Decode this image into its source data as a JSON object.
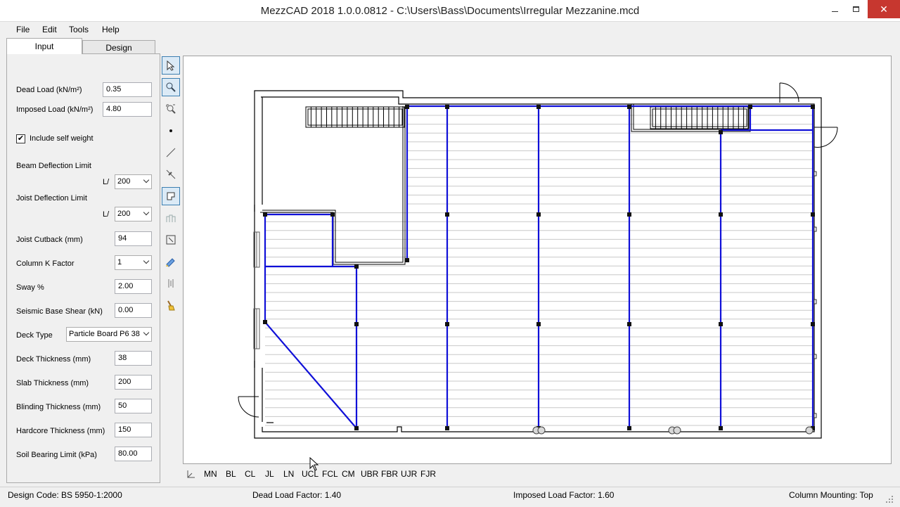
{
  "window": {
    "title": "MezzCAD 2018 1.0.0.0812 - C:\\Users\\Bass\\Documents\\Irregular Mezzanine.mcd",
    "close_glyph": "✕"
  },
  "menu": {
    "file": "File",
    "edit": "Edit",
    "tools": "Tools",
    "help": "Help"
  },
  "tabs": {
    "input": "Input",
    "design": "Design"
  },
  "form": {
    "dead_load_label": "Dead Load (kN/m²)",
    "dead_load_value": "0.35",
    "imposed_load_label": "Imposed Load (kN/m²)",
    "imposed_load_value": "4.80",
    "self_weight_label": "Include self weight",
    "self_weight_checked": "✔",
    "beam_deflection_label": "Beam Deflection Limit",
    "beam_l_prefix": "L/",
    "beam_deflection_value": "200",
    "joist_deflection_label": "Joist Deflection Limit",
    "joist_l_prefix": "L/",
    "joist_deflection_value": "200",
    "joist_cutback_label": "Joist Cutback (mm)",
    "joist_cutback_value": "94",
    "column_k_label": "Column K Factor",
    "column_k_value": "1",
    "sway_label": "Sway %",
    "sway_value": "2.00",
    "seismic_label": "Seismic Base Shear (kN)",
    "seismic_value": "0.00",
    "deck_type_label": "Deck Type",
    "deck_type_value": "Particle Board P6 38",
    "deck_thickness_label": "Deck Thickness (mm)",
    "deck_thickness_value": "38",
    "slab_thickness_label": "Slab Thickness (mm)",
    "slab_thickness_value": "200",
    "blinding_label": "Blinding Thickness (mm)",
    "blinding_value": "50",
    "hardcore_label": "Hardcore Thickness (mm)",
    "hardcore_value": "150",
    "soil_label": "Soil Bearing Limit (kPa)",
    "soil_value": "80.00"
  },
  "view_toolbar": [
    "MN",
    "BL",
    "CL",
    "JL",
    "LN",
    "UCL",
    "FCL",
    "CM",
    "UBR",
    "FBR",
    "UJR",
    "FJR"
  ],
  "status": {
    "design_code": "Design Code:  BS 5950-1:2000",
    "dead_load_factor": "Dead Load Factor:  1.40",
    "imposed_load_factor": "Imposed Load Factor:  1.60",
    "column_mounting": "Column Mounting:  Top"
  },
  "colors": {
    "beam": "#1010d8",
    "joist": "#c8c8c8",
    "wall": "#000000",
    "accent": "#3c7fb1"
  }
}
